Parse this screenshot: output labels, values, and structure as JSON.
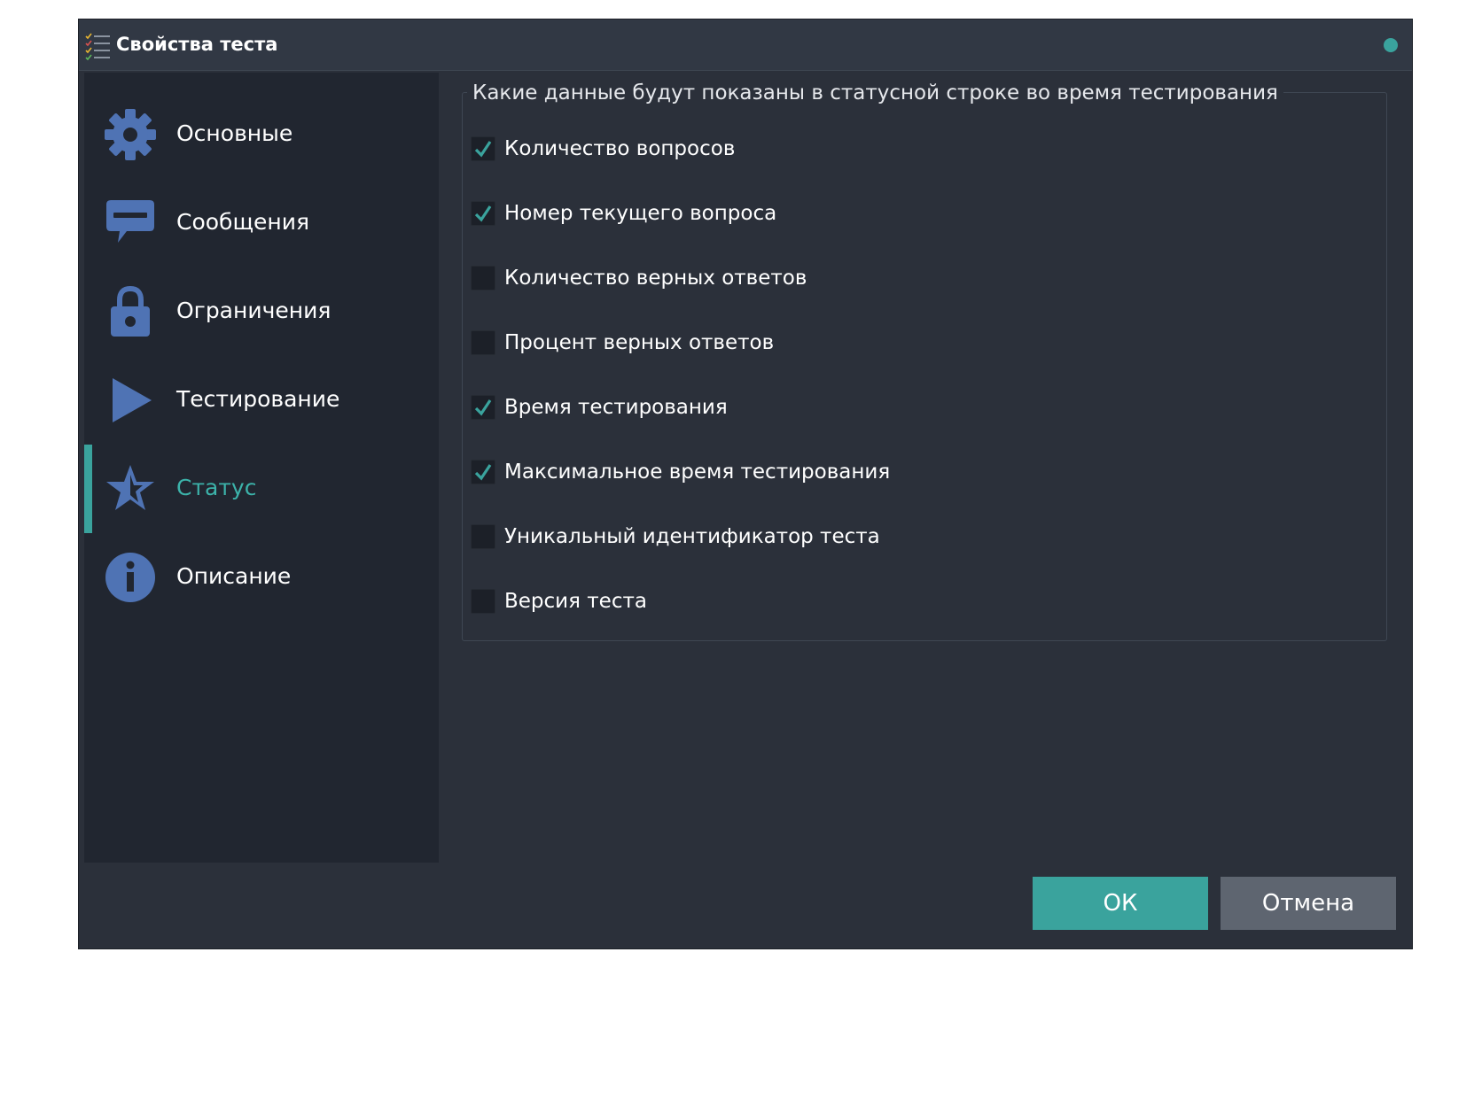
{
  "window": {
    "title": "Свойства теста"
  },
  "colors": {
    "accent": "#3aa39d",
    "nav_icon": "#4f73b4",
    "background": "#2b303a",
    "sidebar": "#212630"
  },
  "sidebar": {
    "items": [
      {
        "label": "Основные",
        "icon": "gear-icon",
        "active": false
      },
      {
        "label": "Сообщения",
        "icon": "message-icon",
        "active": false
      },
      {
        "label": "Ограничения",
        "icon": "lock-icon",
        "active": false
      },
      {
        "label": "Тестирование",
        "icon": "play-icon",
        "active": false
      },
      {
        "label": "Статус",
        "icon": "star-icon",
        "active": true
      },
      {
        "label": "Описание",
        "icon": "info-icon",
        "active": false
      }
    ]
  },
  "status_group": {
    "title": "Какие данные будут показаны в статусной строке во время тестирования",
    "options": [
      {
        "label": "Количество вопросов",
        "checked": true
      },
      {
        "label": "Номер текущего вопроса",
        "checked": true
      },
      {
        "label": "Количество верных ответов",
        "checked": false
      },
      {
        "label": "Процент верных ответов",
        "checked": false
      },
      {
        "label": "Время тестирования",
        "checked": true
      },
      {
        "label": "Максимальное время тестирования",
        "checked": true
      },
      {
        "label": "Уникальный идентификатор теста",
        "checked": false
      },
      {
        "label": "Версия теста",
        "checked": false
      }
    ]
  },
  "buttons": {
    "ok": "ОК",
    "cancel": "Отмена"
  }
}
